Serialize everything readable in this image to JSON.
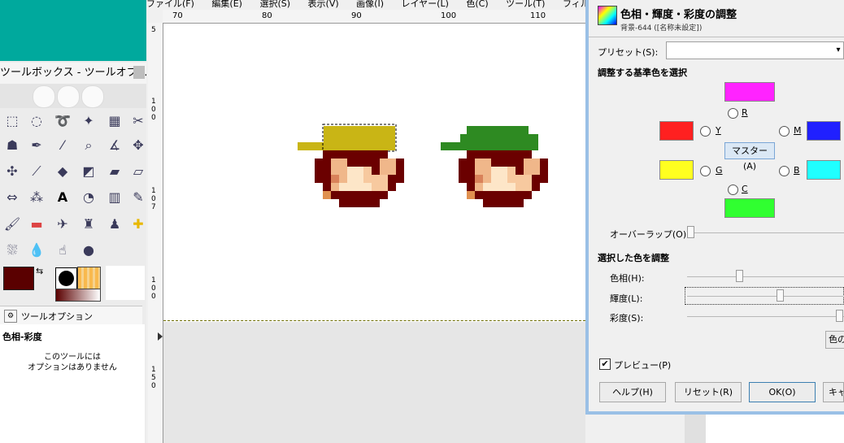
{
  "toolbox": {
    "title": "ツールボックス - ツールオプ…",
    "tool_options_tab": "ツールオプション",
    "tool_options_header": "色相-彩度",
    "tool_options_msg_1": "このツールには",
    "tool_options_msg_2": "オプションはありません",
    "fg_color": "#5a0000",
    "bg_color": "#ffffff"
  },
  "image_window": {
    "menu": [
      "ファイル(F)",
      "編集(E)",
      "選択(S)",
      "表示(V)",
      "画像(I)",
      "レイヤー(L)",
      "色(C)",
      "ツール(T)",
      "フィルター(R)"
    ],
    "hruler_ticks": [
      "70",
      "80",
      "90",
      "100",
      "110"
    ],
    "vruler_labels": [
      "5",
      "1\n0\n0",
      "1\n5\n0",
      "1\n0\n0",
      "5",
      "1\n5\n0"
    ]
  },
  "dialog": {
    "title": "色相・輝度・彩度の調整",
    "subtitle": "背景-644 ([名称未設定])",
    "preset_label": "プリセット(S):",
    "preset_value": "",
    "section_primary": "調整する基準色を選択",
    "radio_r": "R",
    "radio_y": "Y",
    "radio_g": "G",
    "radio_c": "C",
    "radio_b": "B",
    "radio_m": "M",
    "master_button": "マスター(A)",
    "colors": {
      "r": "#ff23ff",
      "y": "#ff2020",
      "g": "#ffff20",
      "c": "#30ff30",
      "b": "#20ffff",
      "m": "#2020ff"
    },
    "overlap_label": "オーバーラップ(O):",
    "section_adjust": "選択した色を調整",
    "hue_label": "色相(H):",
    "lightness_label": "輝度(L):",
    "saturation_label": "彩度(S):",
    "colorize_button": "色の",
    "preview_label": "プレビュー(P)",
    "preview_checked": "✔",
    "help_button": "ヘルプ(H)",
    "reset_button": "リセット(R)",
    "ok_button": "OK(O)",
    "cancel_button": "キャ"
  }
}
